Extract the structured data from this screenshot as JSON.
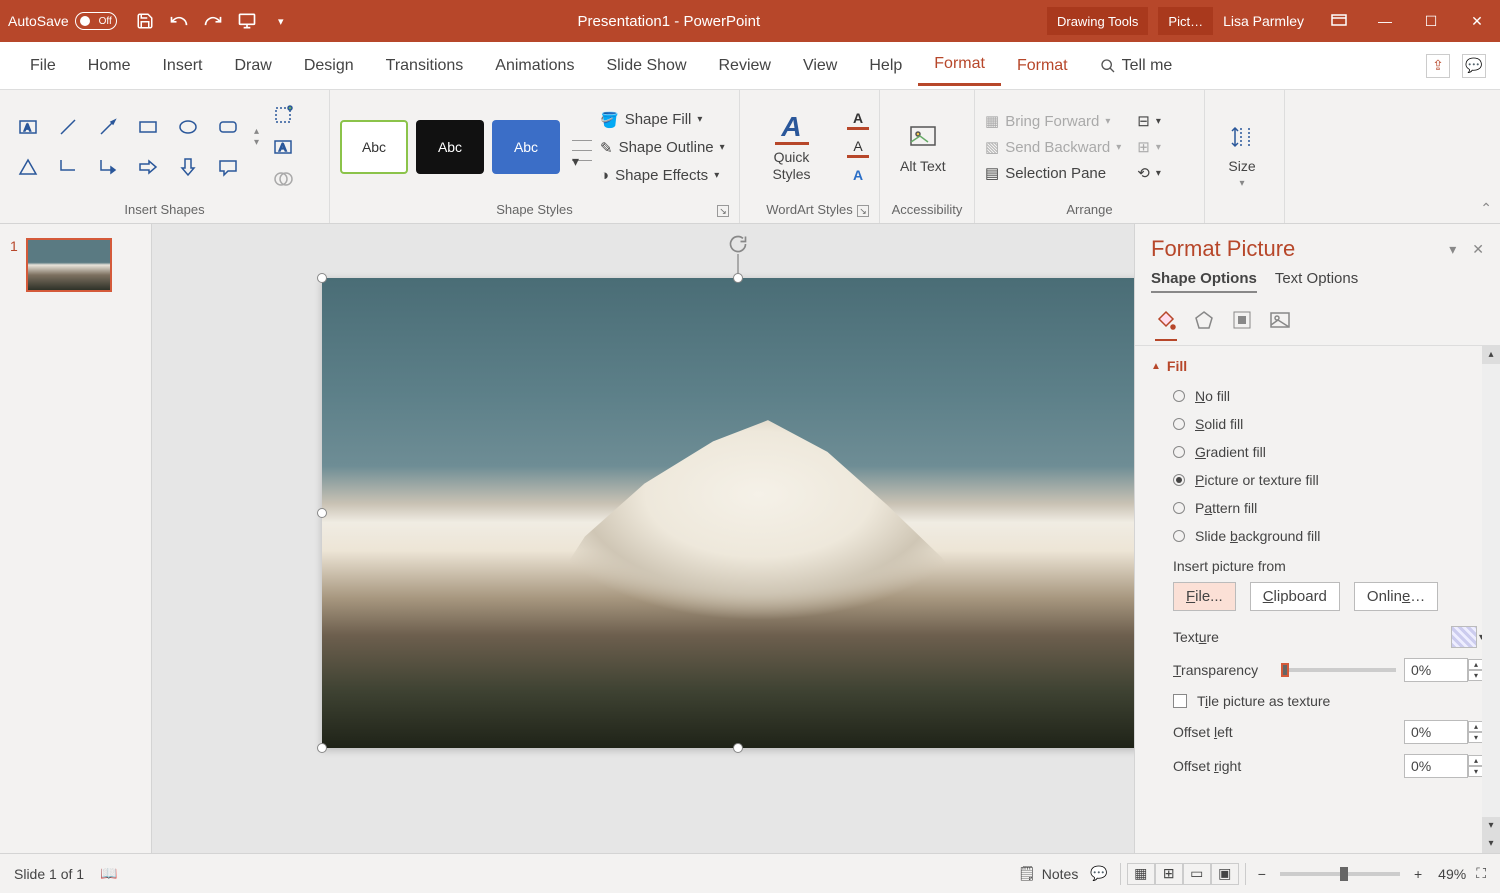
{
  "titlebar": {
    "autosave_label": "AutoSave",
    "autosave_state": "Off",
    "doc_title": "Presentation1  -  PowerPoint",
    "context_tool1": "Drawing Tools",
    "context_tool2": "Pict…",
    "user_name": "Lisa Parmley"
  },
  "tabs": {
    "file": "File",
    "home": "Home",
    "insert": "Insert",
    "draw": "Draw",
    "design": "Design",
    "transitions": "Transitions",
    "animations": "Animations",
    "slideshow": "Slide Show",
    "review": "Review",
    "view": "View",
    "help": "Help",
    "format1": "Format",
    "format2": "Format",
    "tellme": "Tell me"
  },
  "ribbon": {
    "group_insert_shapes": "Insert Shapes",
    "group_shape_styles": "Shape Styles",
    "group_wordart": "WordArt Styles",
    "group_access": "Accessibility",
    "group_arrange": "Arrange",
    "group_size": "Size",
    "abc": "Abc",
    "shape_fill": "Shape Fill",
    "shape_outline": "Shape Outline",
    "shape_effects": "Shape Effects",
    "quick_styles": "Quick Styles",
    "alt_text": "Alt Text",
    "bring_forward": "Bring Forward",
    "send_backward": "Send Backward",
    "selection_pane": "Selection Pane",
    "size": "Size"
  },
  "thumb": {
    "num": "1"
  },
  "pane": {
    "title": "Format Picture",
    "shape_options": "Shape Options",
    "text_options": "Text Options",
    "section_fill": "Fill",
    "no_fill": "No fill",
    "solid_fill": "Solid fill",
    "gradient_fill": "Gradient fill",
    "picture_fill": "Picture or texture fill",
    "pattern_fill": "Pattern fill",
    "slide_bg_fill": "Slide background fill",
    "insert_from": "Insert picture from",
    "file_btn": "File...",
    "clipboard_btn": "Clipboard",
    "online_btn": "Online…",
    "texture": "Texture",
    "transparency": "Transparency",
    "transparency_val": "0%",
    "tile": "Tile picture as texture",
    "offset_left": "Offset left",
    "offset_left_val": "0%",
    "offset_right": "Offset right",
    "offset_right_val": "0%"
  },
  "status": {
    "slide": "Slide 1 of 1",
    "notes": "Notes",
    "zoom": "49%"
  }
}
